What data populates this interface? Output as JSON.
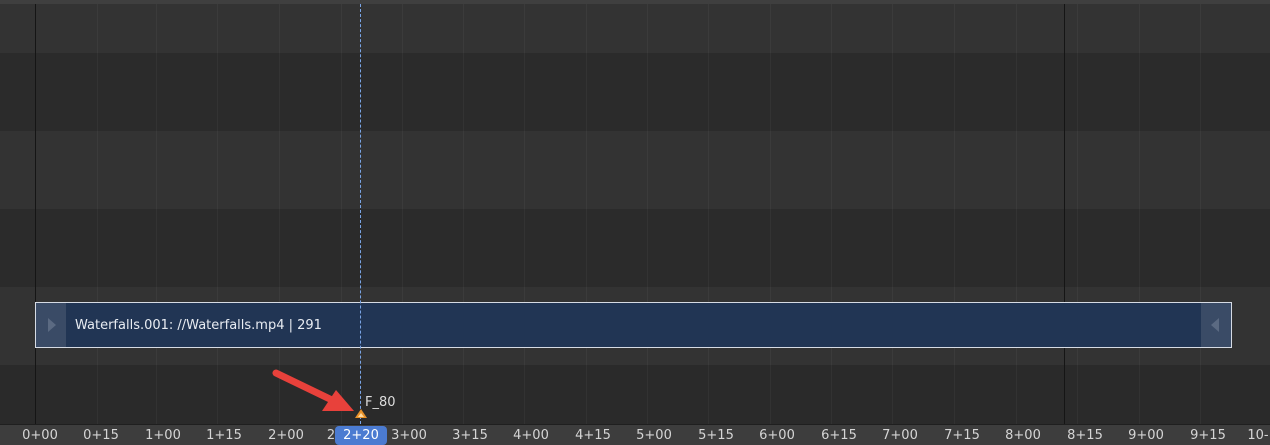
{
  "strip": {
    "label": "Waterfalls.001: //Waterfalls.mp4 | 291",
    "color": "#213554"
  },
  "marker": {
    "label": "F_80",
    "color": "#e8922a"
  },
  "playhead": {
    "current_frame": "2+20",
    "color": "#4b7bd1"
  },
  "annotation": {
    "arrow_color": "#e8413b"
  },
  "ruler": {
    "ticks": [
      "0+00",
      "0+15",
      "1+00",
      "1+15",
      "2+00",
      "2",
      "3+00",
      "3+15",
      "4+00",
      "4+15",
      "5+00",
      "5+15",
      "6+00",
      "6+15",
      "7+00",
      "7+15",
      "8+00",
      "8+15",
      "9+00",
      "9+15",
      "10-"
    ]
  }
}
